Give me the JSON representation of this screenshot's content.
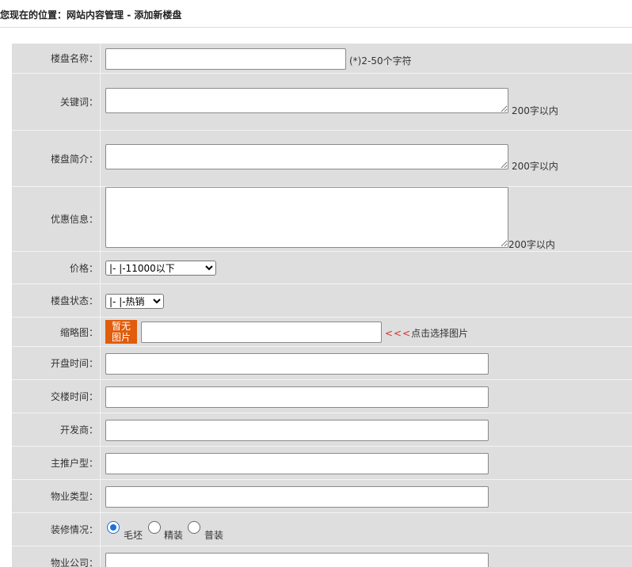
{
  "breadcrumb": {
    "prefix": "您现在的位置：",
    "path": "网站内容管理 - 添加新楼盘"
  },
  "form": {
    "name": {
      "label": "楼盘名称：",
      "value": "",
      "hint": "(*)2-50个字符"
    },
    "keywords": {
      "label": "关键词：",
      "value": "",
      "hint": "200字以内"
    },
    "intro": {
      "label": "楼盘简介：",
      "value": "",
      "hint": "200字以内"
    },
    "promo": {
      "label": "优惠信息：",
      "value": "",
      "hint": "200字以内"
    },
    "price": {
      "label": "价格：",
      "selected": "|- |-11000以下"
    },
    "status": {
      "label": "楼盘状态：",
      "selected": "|- |-热销"
    },
    "thumbnail": {
      "label": "缩略图：",
      "button_line1": "暂无",
      "button_line2": "图片",
      "value": "",
      "arrows": "<<<",
      "hint": "点击选择图片"
    },
    "open_time": {
      "label": "开盘时间：",
      "value": ""
    },
    "delivery_time": {
      "label": "交楼时间：",
      "value": ""
    },
    "developer": {
      "label": "开发商：",
      "value": ""
    },
    "main_unit": {
      "label": "主推户型：",
      "value": ""
    },
    "property_type": {
      "label": "物业类型：",
      "value": ""
    },
    "decoration": {
      "label": "装修情况：",
      "options": [
        "毛坯",
        "精装",
        "普装"
      ],
      "selected": "毛坯"
    },
    "property_company": {
      "label": "物业公司：",
      "value": ""
    }
  }
}
